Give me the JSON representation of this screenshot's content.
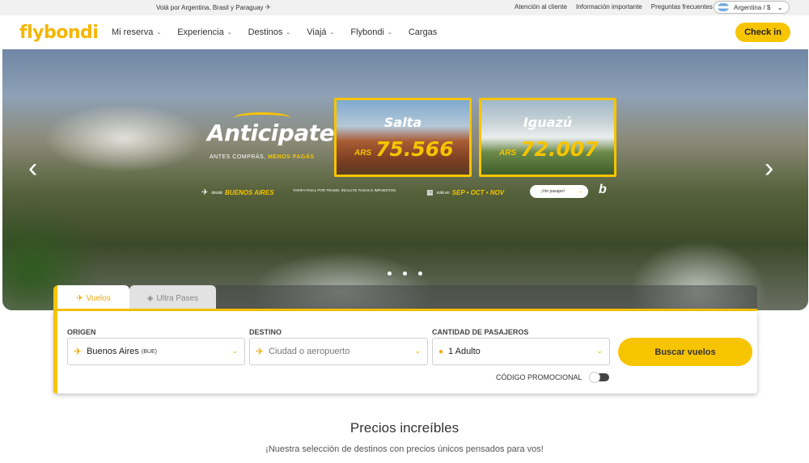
{
  "topbar": {
    "promo": "Volá por Argentina, Brasil y Paraguay",
    "links": [
      "Atención al cliente",
      "Información importante",
      "Preguntas frecuentes"
    ],
    "country": "Argentina / $"
  },
  "nav": {
    "logo": "flybondi",
    "menu": [
      {
        "label": "Mi reserva",
        "dropdown": true
      },
      {
        "label": "Experiencia",
        "dropdown": true
      },
      {
        "label": "Destinos",
        "dropdown": true
      },
      {
        "label": "Viajá",
        "dropdown": true
      },
      {
        "label": "Flybondi",
        "dropdown": true
      },
      {
        "label": "Cargas",
        "dropdown": false
      }
    ],
    "checkin": "Check in"
  },
  "hero": {
    "headline": "Anticipate",
    "subline_a": "ANTES COMPRÁS,",
    "subline_b": "MENOS PAGÁS",
    "cards": [
      {
        "city": "Salta",
        "currency": "ARS",
        "price": "75.566"
      },
      {
        "city": "Iguazú",
        "currency": "ARS",
        "price": "72.007"
      }
    ],
    "from_small": "desde",
    "from_city": "BUENOS AIRES",
    "disclaimer": "TARIFA FINAL POR TRAMO. INCLUYE TASAS E IMPUESTOS.",
    "valid_small": "volá en",
    "valid_months": "SEP • OCT • NOV",
    "cta": "¡Ver pasajes!",
    "slides": 3,
    "accent": "#f7c400"
  },
  "booking": {
    "tabs": [
      {
        "label": "Vuelos",
        "active": true
      },
      {
        "label": "Ultra Pases",
        "active": false
      }
    ],
    "origin": {
      "label": "ORIGEN",
      "value": "Buenos Aires",
      "code": "(BUE)"
    },
    "destination": {
      "label": "DESTINO",
      "placeholder": "Ciudad o aeropuerto"
    },
    "passengers": {
      "label": "CANTIDAD DE PASAJEROS",
      "value": "1 Adulto"
    },
    "search": "Buscar vuelos",
    "promo_code": "CÓDIGO PROMOCIONAL"
  },
  "section": {
    "title": "Precios increíbles",
    "subtitle": "¡Nuestra selección de destinos con precios únicos pensados para vos!"
  }
}
